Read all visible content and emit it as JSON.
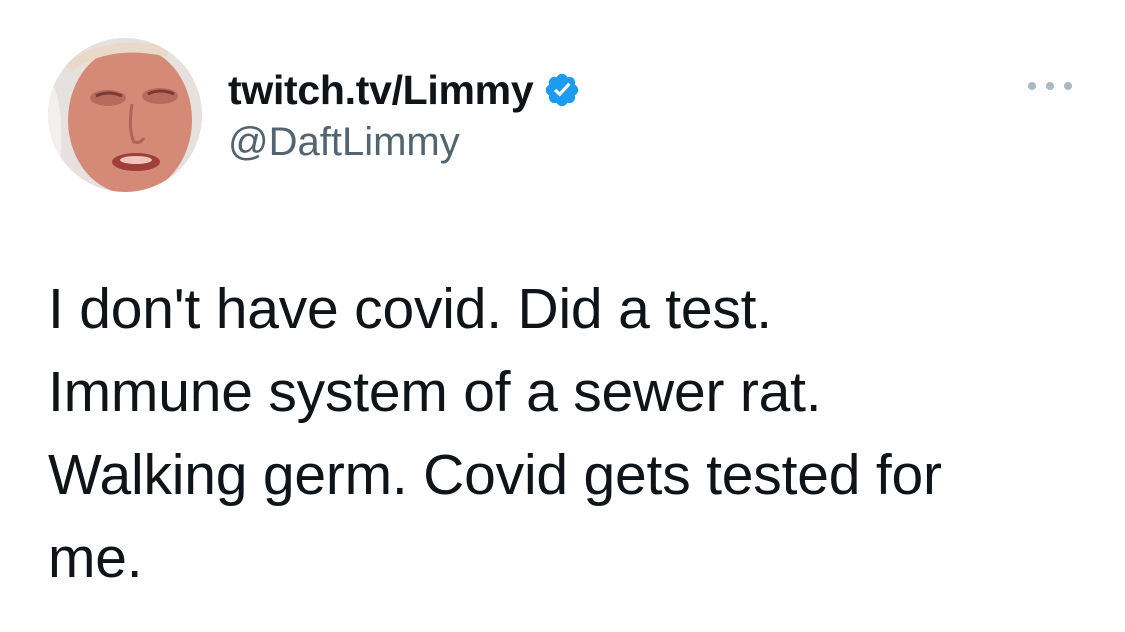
{
  "author": {
    "display_name": "twitch.tv/Limmy",
    "handle": "@DaftLimmy",
    "verified_icon": "verified-badge-icon",
    "avatar_icon": "profile-avatar"
  },
  "tweet": {
    "lines": [
      "I don't have covid. Did a test.",
      "Immune system of a sewer rat.",
      "Walking germ. Covid gets tested for",
      "me."
    ]
  },
  "menu": {
    "icon": "more-options-icon"
  },
  "colors": {
    "text_primary": "#0f1419",
    "text_secondary": "#536471",
    "verified_blue": "#1d9bf0",
    "more_dots": "#aab8c2",
    "background": "#ffffff"
  }
}
